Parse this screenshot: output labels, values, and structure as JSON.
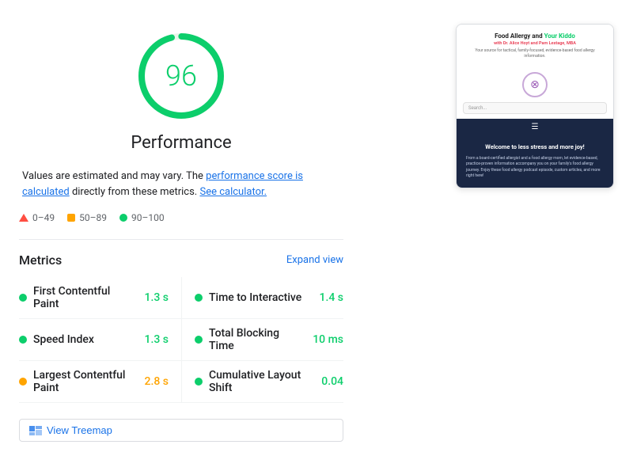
{
  "score": {
    "value": "96",
    "label": "Performance",
    "color": "#0cce6b"
  },
  "description": {
    "text1": "Values are estimated and may vary. The ",
    "link1": "performance score is calculated",
    "text2": " directly from these metrics. ",
    "link2": "See calculator."
  },
  "legend": {
    "items": [
      {
        "range": "0–49",
        "type": "triangle",
        "color": "#ff4e42"
      },
      {
        "range": "50–89",
        "type": "square",
        "color": "#ffa400"
      },
      {
        "range": "90–100",
        "type": "circle",
        "color": "#0cce6b"
      }
    ]
  },
  "metrics": {
    "title": "Metrics",
    "expand_label": "Expand view",
    "items": [
      {
        "name": "First Contentful Paint",
        "value": "1.3 s",
        "color": "green",
        "side": "left"
      },
      {
        "name": "Time to Interactive",
        "value": "1.4 s",
        "color": "green",
        "side": "right"
      },
      {
        "name": "Speed Index",
        "value": "1.3 s",
        "color": "green",
        "side": "left"
      },
      {
        "name": "Total Blocking Time",
        "value": "10 ms",
        "color": "green",
        "side": "right"
      },
      {
        "name": "Largest Contentful Paint",
        "value": "2.8 s",
        "color": "orange",
        "side": "left"
      },
      {
        "name": "Cumulative Layout Shift",
        "value": "0.04",
        "color": "green",
        "side": "right"
      }
    ]
  },
  "treemap": {
    "label": "View Treemap"
  },
  "preview": {
    "title_part1": "Food Allergy and ",
    "title_part2": "Your Kiddo",
    "authors": "with Dr. Alice Hoyt and Pam Lestage, MBA",
    "tagline": "Your source for tactical, family-focused, evidence-based food allergy information.",
    "search_placeholder": "Search...",
    "hero_title": "Welcome to less stress and more joy!",
    "hero_text": "From a board-certified allergist and a food allergy mom, let evidence-based, practice-proven information accompany you on your family's food allergy journey. Enjoy these food allergy podcast episode, custom articles, and more right here!"
  }
}
